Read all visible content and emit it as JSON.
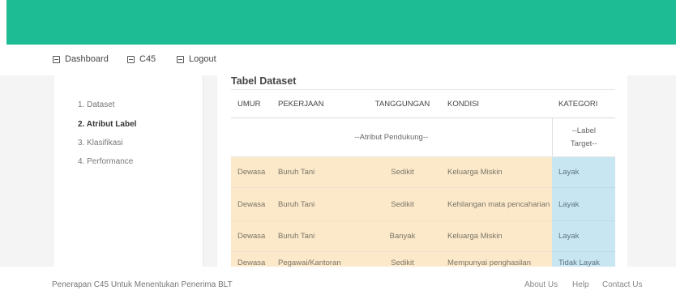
{
  "nav": {
    "items": [
      {
        "label": "Dashboard",
        "icon": "dashboard-icon"
      },
      {
        "label": "C45",
        "icon": "list-icon"
      },
      {
        "label": "Logout",
        "icon": "list-icon"
      }
    ]
  },
  "sidebar": {
    "items": [
      {
        "label": "1. Dataset",
        "active": false
      },
      {
        "label": "2. Atribut Label",
        "active": true
      },
      {
        "label": "3. Klasifikasi",
        "active": false
      },
      {
        "label": "4. Performance",
        "active": false
      }
    ]
  },
  "main": {
    "title": "Tabel Dataset",
    "table": {
      "headers": [
        "UMUR",
        "PEKERJAAN",
        "TANGGUNGAN",
        "KONDISI",
        "KATEGORI"
      ],
      "subheader": {
        "pendukung": "--Atribut Pendukung--",
        "label_line1": "--Label",
        "label_line2": "Target--"
      },
      "rows": [
        [
          "Dewasa",
          "Buruh Tani",
          "Sedikit",
          "Keluarga Miskin",
          "Layak"
        ],
        [
          "Dewasa",
          "Buruh Tani",
          "Sedikit",
          "Kehilangan mata pencaharian",
          "Layak"
        ],
        [
          "Dewasa",
          "Buruh Tani",
          "Banyak",
          "Keluarga Miskin",
          "Layak"
        ],
        [
          "Dewasa",
          "Pegawai/Kantoran",
          "Sedikit",
          "Mempunyai penghasilan",
          "Tidak Layak"
        ]
      ]
    }
  },
  "footer": {
    "text": "Penerapan C45 Untuk Menentukan Penerima BLT",
    "links": [
      "About Us",
      "Help",
      "Contact Us"
    ]
  },
  "colors": {
    "header": "#1ebc94",
    "attribute_cells": "#fce9ca",
    "label_cells": "#c8e6f2"
  }
}
